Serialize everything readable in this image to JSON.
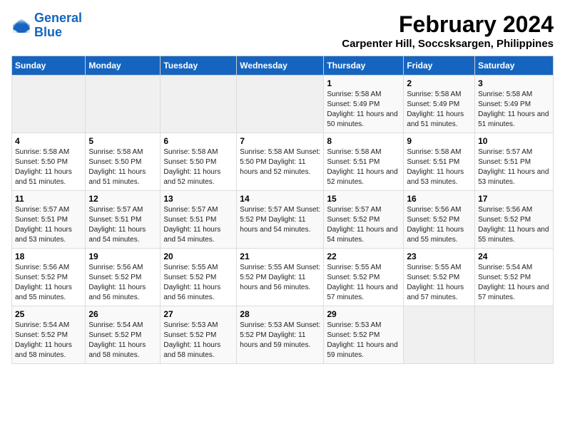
{
  "logo": {
    "line1": "General",
    "line2": "Blue"
  },
  "title": "February 2024",
  "subtitle": "Carpenter Hill, Soccsksargen, Philippines",
  "headers": [
    "Sunday",
    "Monday",
    "Tuesday",
    "Wednesday",
    "Thursday",
    "Friday",
    "Saturday"
  ],
  "weeks": [
    [
      {
        "day": "",
        "info": ""
      },
      {
        "day": "",
        "info": ""
      },
      {
        "day": "",
        "info": ""
      },
      {
        "day": "",
        "info": ""
      },
      {
        "day": "1",
        "info": "Sunrise: 5:58 AM\nSunset: 5:49 PM\nDaylight: 11 hours and 50 minutes."
      },
      {
        "day": "2",
        "info": "Sunrise: 5:58 AM\nSunset: 5:49 PM\nDaylight: 11 hours and 51 minutes."
      },
      {
        "day": "3",
        "info": "Sunrise: 5:58 AM\nSunset: 5:49 PM\nDaylight: 11 hours and 51 minutes."
      }
    ],
    [
      {
        "day": "4",
        "info": "Sunrise: 5:58 AM\nSunset: 5:50 PM\nDaylight: 11 hours and 51 minutes."
      },
      {
        "day": "5",
        "info": "Sunrise: 5:58 AM\nSunset: 5:50 PM\nDaylight: 11 hours and 51 minutes."
      },
      {
        "day": "6",
        "info": "Sunrise: 5:58 AM\nSunset: 5:50 PM\nDaylight: 11 hours and 52 minutes."
      },
      {
        "day": "7",
        "info": "Sunrise: 5:58 AM\nSunset: 5:50 PM\nDaylight: 11 hours and 52 minutes."
      },
      {
        "day": "8",
        "info": "Sunrise: 5:58 AM\nSunset: 5:51 PM\nDaylight: 11 hours and 52 minutes."
      },
      {
        "day": "9",
        "info": "Sunrise: 5:58 AM\nSunset: 5:51 PM\nDaylight: 11 hours and 53 minutes."
      },
      {
        "day": "10",
        "info": "Sunrise: 5:57 AM\nSunset: 5:51 PM\nDaylight: 11 hours and 53 minutes."
      }
    ],
    [
      {
        "day": "11",
        "info": "Sunrise: 5:57 AM\nSunset: 5:51 PM\nDaylight: 11 hours and 53 minutes."
      },
      {
        "day": "12",
        "info": "Sunrise: 5:57 AM\nSunset: 5:51 PM\nDaylight: 11 hours and 54 minutes."
      },
      {
        "day": "13",
        "info": "Sunrise: 5:57 AM\nSunset: 5:51 PM\nDaylight: 11 hours and 54 minutes."
      },
      {
        "day": "14",
        "info": "Sunrise: 5:57 AM\nSunset: 5:52 PM\nDaylight: 11 hours and 54 minutes."
      },
      {
        "day": "15",
        "info": "Sunrise: 5:57 AM\nSunset: 5:52 PM\nDaylight: 11 hours and 54 minutes."
      },
      {
        "day": "16",
        "info": "Sunrise: 5:56 AM\nSunset: 5:52 PM\nDaylight: 11 hours and 55 minutes."
      },
      {
        "day": "17",
        "info": "Sunrise: 5:56 AM\nSunset: 5:52 PM\nDaylight: 11 hours and 55 minutes."
      }
    ],
    [
      {
        "day": "18",
        "info": "Sunrise: 5:56 AM\nSunset: 5:52 PM\nDaylight: 11 hours and 55 minutes."
      },
      {
        "day": "19",
        "info": "Sunrise: 5:56 AM\nSunset: 5:52 PM\nDaylight: 11 hours and 56 minutes."
      },
      {
        "day": "20",
        "info": "Sunrise: 5:55 AM\nSunset: 5:52 PM\nDaylight: 11 hours and 56 minutes."
      },
      {
        "day": "21",
        "info": "Sunrise: 5:55 AM\nSunset: 5:52 PM\nDaylight: 11 hours and 56 minutes."
      },
      {
        "day": "22",
        "info": "Sunrise: 5:55 AM\nSunset: 5:52 PM\nDaylight: 11 hours and 57 minutes."
      },
      {
        "day": "23",
        "info": "Sunrise: 5:55 AM\nSunset: 5:52 PM\nDaylight: 11 hours and 57 minutes."
      },
      {
        "day": "24",
        "info": "Sunrise: 5:54 AM\nSunset: 5:52 PM\nDaylight: 11 hours and 57 minutes."
      }
    ],
    [
      {
        "day": "25",
        "info": "Sunrise: 5:54 AM\nSunset: 5:52 PM\nDaylight: 11 hours and 58 minutes."
      },
      {
        "day": "26",
        "info": "Sunrise: 5:54 AM\nSunset: 5:52 PM\nDaylight: 11 hours and 58 minutes."
      },
      {
        "day": "27",
        "info": "Sunrise: 5:53 AM\nSunset: 5:52 PM\nDaylight: 11 hours and 58 minutes."
      },
      {
        "day": "28",
        "info": "Sunrise: 5:53 AM\nSunset: 5:52 PM\nDaylight: 11 hours and 59 minutes."
      },
      {
        "day": "29",
        "info": "Sunrise: 5:53 AM\nSunset: 5:52 PM\nDaylight: 11 hours and 59 minutes."
      },
      {
        "day": "",
        "info": ""
      },
      {
        "day": "",
        "info": ""
      }
    ]
  ]
}
